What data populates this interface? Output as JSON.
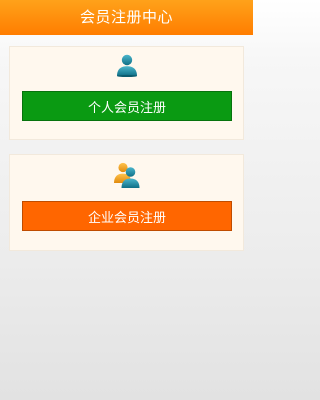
{
  "header": {
    "title": "会员注册中心"
  },
  "personal": {
    "icon": "single-user-icon",
    "button_label": "个人会员注册",
    "button_color": "#0a9a12"
  },
  "company": {
    "icon": "group-users-icon",
    "button_label": "企业会员注册",
    "button_color": "#ff6600"
  },
  "colors": {
    "header_accent": "#ff8a00",
    "card_background": "#fff8ee",
    "user_icon_teal": "#1a8aa0",
    "user_icon_orange": "#f3a11d"
  }
}
